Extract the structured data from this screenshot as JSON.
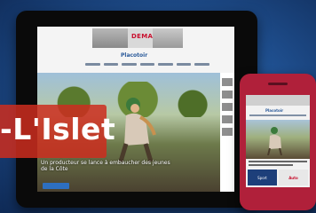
{
  "overlay": {
    "title": "-L'Islet"
  },
  "tablet": {
    "banner": {
      "brand": "DEMAIS"
    },
    "site_logo": "Placotoir",
    "hero_caption": "Un producteur se lance à embaucher des jeunes de la Côte"
  },
  "phone": {
    "site_logo": "Placotoir",
    "ads": [
      "Sport",
      "Auto"
    ]
  },
  "colors": {
    "tag": "#cd2d1e",
    "phone_case": "#b0203a",
    "background": "#2f6fb3"
  }
}
